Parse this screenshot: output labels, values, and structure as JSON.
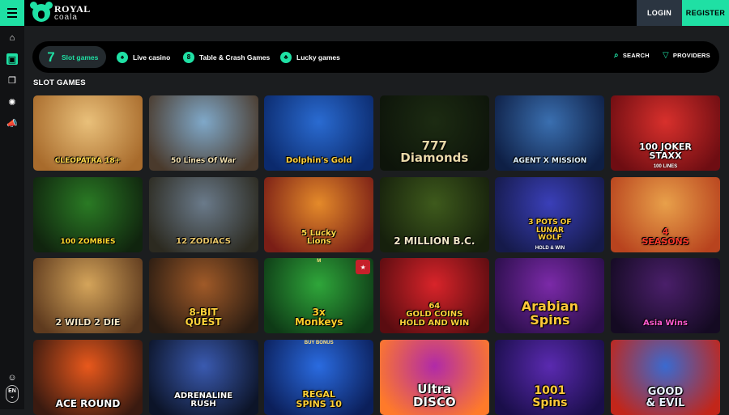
{
  "header": {
    "logo_top": "ROYAL",
    "logo_bottom": "coala",
    "login_label": "LOGIN",
    "register_label": "REGISTER"
  },
  "sidebar": {
    "items": [
      {
        "icon": "home-icon",
        "glyph": "⌂",
        "active": false
      },
      {
        "icon": "slots-icon",
        "glyph": "▣",
        "active": true
      },
      {
        "icon": "cards-icon",
        "glyph": "❐",
        "active": false
      },
      {
        "icon": "settings-icon",
        "glyph": "✺",
        "active": false
      },
      {
        "icon": "promotions-icon",
        "glyph": "📣",
        "active": false
      }
    ],
    "chat_glyph": "☺",
    "language": "EN",
    "language_arrow": "⌄"
  },
  "tabs": [
    {
      "label": "Slot games",
      "icon": "seven-icon",
      "glyph": "7",
      "active": true
    },
    {
      "label": "Live casino",
      "icon": "spade-chip-icon",
      "glyph": "♠",
      "active": false
    },
    {
      "label": "Table & Crash Games",
      "icon": "eight-ball-icon",
      "glyph": "8",
      "active": false
    },
    {
      "label": "Lucky games",
      "icon": "clover-icon",
      "glyph": "♣",
      "active": false
    }
  ],
  "tools": {
    "search_label": "SEARCH",
    "search_icon": "search-icon",
    "providers_label": "PROVIDERS",
    "providers_icon": "filter-icon"
  },
  "section_title": "SLOT GAMES",
  "games": [
    {
      "title": "CLEOPATRA 18+",
      "color1": "#e9c07a",
      "color2": "#a86b2c",
      "text_color": "#ffd84a",
      "size": 9
    },
    {
      "title": "50 Lines Of War",
      "color1": "#7fa8c9",
      "color2": "#4a3a2c",
      "text_color": "#f2e0b0",
      "size": 9
    },
    {
      "title": "Dolphin's Gold",
      "color1": "#2a6bd1",
      "color2": "#0b2a6d",
      "text_color": "#ffd23f",
      "size": 10
    },
    {
      "title": "777\nDiamonds",
      "color1": "#1c2b12",
      "color2": "#0d140a",
      "text_color": "#e9d9a8",
      "size": 15
    },
    {
      "title": "AGENT X MISSION",
      "color1": "#3a6fb0",
      "color2": "#0e1f45",
      "text_color": "#dff2ff",
      "size": 9
    },
    {
      "title": "100 JOKER\nSTAXX",
      "sub": "100 LINES",
      "color1": "#d8302c",
      "color2": "#6e0d12",
      "text_color": "#ffffff",
      "size": 11
    },
    {
      "title": "100 ZOMBIES",
      "color1": "#2a7a24",
      "color2": "#10240e",
      "text_color": "#ffdc2e",
      "size": 9
    },
    {
      "title": "12 ZODIACS",
      "color1": "#6a7a8a",
      "color2": "#2c2a20",
      "text_color": "#e8c66a",
      "size": 10
    },
    {
      "title": "5 Lucky\nLions",
      "color1": "#e48a2a",
      "color2": "#7a1e16",
      "text_color": "#ffd94a",
      "size": 10
    },
    {
      "title": "2 MILLION B.C.",
      "color1": "#3e5a1c",
      "color2": "#16200c",
      "text_color": "#f0e6c8",
      "size": 12
    },
    {
      "title": "3 POTS OF\nLUNAR\nWOLF",
      "sub": "HOLD & WIN",
      "color1": "#3a3fb8",
      "color2": "#151a4a",
      "text_color": "#ffcf3a",
      "size": 9
    },
    {
      "title": "4\nSEASONS",
      "color1": "#e8a04a",
      "color2": "#b8431e",
      "text_color": "#ff3a2a",
      "size": 11
    },
    {
      "title": "2 WILD 2 DIE",
      "color1": "#d4a45a",
      "color2": "#5e3a1e",
      "text_color": "#f5e6c6",
      "size": 11
    },
    {
      "title": "8-BIT\nQUEST",
      "color1": "#a05a28",
      "color2": "#2a1c12",
      "text_color": "#ffd23a",
      "size": 12
    },
    {
      "title": "3x\nMonkeys",
      "tag": "M",
      "badge": "★",
      "color1": "#2fa63a",
      "color2": "#0e3a16",
      "text_color": "#ffcf2a",
      "size": 12
    },
    {
      "title": "64\nGOLD COINS\nHOLD AND WIN",
      "color1": "#d8242a",
      "color2": "#5a0c10",
      "text_color": "#ffd13a",
      "size": 10
    },
    {
      "title": "Arabian\nSpins",
      "color1": "#7b2aa8",
      "color2": "#2a0e4a",
      "text_color": "#ffc83a",
      "size": 16
    },
    {
      "title": "Asia Wins",
      "color1": "#4a1f6a",
      "color2": "#140a22",
      "text_color": "#ff5ad0",
      "size": 10
    },
    {
      "title": "ACE ROUND",
      "color1": "#e8581c",
      "color2": "#3a1a10",
      "text_color": "#ffffff",
      "size": 12
    },
    {
      "title": "ADRENALINE\nRUSH",
      "color1": "#3a5ab0",
      "color2": "#0c1428",
      "text_color": "#ffffff",
      "size": 10
    },
    {
      "title": "REGAL\nSPINS 10",
      "tag": "BUY BONUS",
      "color1": "#2a6be0",
      "color2": "#0b1f5a",
      "text_color": "#ffd23a",
      "size": 11
    },
    {
      "title": "Ultra\nDISCO",
      "color1": "#b02aa8",
      "color2": "#ff7a2a",
      "text_color": "#ffffff",
      "size": 15
    },
    {
      "title": "1001\nSpins",
      "color1": "#5a2ab0",
      "color2": "#1a0e4a",
      "text_color": "#ffc83a",
      "size": 14
    },
    {
      "title": "GOOD\n& EVIL",
      "color1": "#3a6ad0",
      "color2": "#c2261a",
      "text_color": "#e8f0ff",
      "size": 13
    }
  ]
}
